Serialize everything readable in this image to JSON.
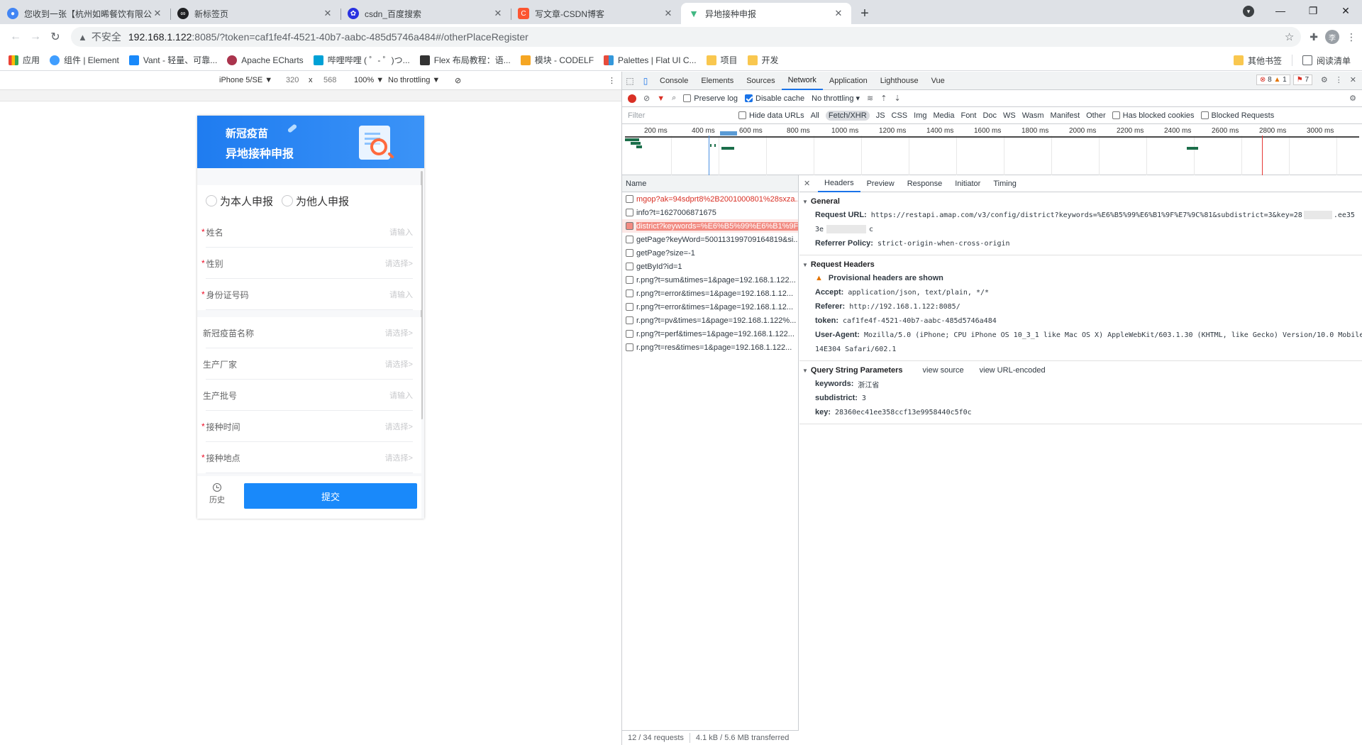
{
  "browser": {
    "tabs": [
      {
        "title": "您收到一张【杭州如晞餐饮有限公司】",
        "icon": "chrome-icon",
        "color": "#4285f4"
      },
      {
        "title": "新标签页",
        "icon": "infinity-icon",
        "color": "#202124"
      },
      {
        "title": "csdn_百度搜索",
        "icon": "baidu-paw-icon",
        "color": "#2932e1"
      },
      {
        "title": "写文章-CSDN博客",
        "icon": "csdn-icon",
        "color": "#fc5531"
      },
      {
        "title": "异地接种申报",
        "icon": "vue-icon",
        "color": "#42b883"
      }
    ],
    "new_tab": "+",
    "url_warning": "不安全",
    "url_host": "192.168.1.122",
    "url_rest": ":8085/?token=caf1fe4f-4521-40b7-aabc-485d5746a484#/otherPlaceRegister",
    "bookmarks": [
      {
        "label": "应用",
        "color": "#4285f4"
      },
      {
        "label": "组件 | Element",
        "color": "#409eff"
      },
      {
        "label": "Vant - 轻量、可靠...",
        "color": "#1989fa"
      },
      {
        "label": "Apache ECharts",
        "color": "#aa344d"
      },
      {
        "label": "哔哩哔哩 ( ゜- ゜)つ...",
        "color": "#00a1d6"
      },
      {
        "label": "Flex 布局教程：语...",
        "color": "#333333"
      },
      {
        "label": "模块 - CODELF",
        "color": "#f5a623"
      },
      {
        "label": "Palettes | Flat UI C...",
        "color": "#e74c3c"
      },
      {
        "label": "项目",
        "color": "#f9c74f"
      },
      {
        "label": "开发",
        "color": "#f9c74f"
      }
    ],
    "other_bookmarks": "其他书签",
    "reading_list": "阅读清单",
    "avatar_letter": "李"
  },
  "device_toolbar": {
    "device": "iPhone 5/SE ▼",
    "width": "320",
    "times": "x",
    "height": "568",
    "zoom": "100% ▼",
    "throttle": "No throttling ▼"
  },
  "app": {
    "banner_line1": "新冠疫苗",
    "banner_line2": "异地接种申报",
    "radio_self": "为本人申报",
    "radio_other": "为他人申报",
    "fields": [
      {
        "label": "姓名",
        "required": "*",
        "placeholder": "请输入"
      },
      {
        "label": "性别",
        "required": "*",
        "placeholder": "请选择>"
      },
      {
        "label": "身份证号码",
        "required": "*",
        "placeholder": "请输入"
      },
      {
        "label": "新冠疫苗名称",
        "required": "",
        "placeholder": "请选择>"
      },
      {
        "label": "生产厂家",
        "required": "",
        "placeholder": "请选择>"
      },
      {
        "label": "生产批号",
        "required": "",
        "placeholder": "请输入"
      },
      {
        "label": "接种时间",
        "required": "*",
        "placeholder": "请选择>"
      },
      {
        "label": "接种地点",
        "required": "*",
        "placeholder": "请选择>"
      }
    ],
    "history": "历史",
    "submit": "提交"
  },
  "devtools": {
    "tabs": [
      "Console",
      "Elements",
      "Sources",
      "Network",
      "Application",
      "Lighthouse",
      "Vue"
    ],
    "active_tab": "Network",
    "errors": "8",
    "warnings": "1",
    "issues": "7",
    "preserve_log": "Preserve log",
    "disable_cache": "Disable cache",
    "throttling": "No throttling",
    "filter_placeholder": "Filter",
    "hide_data_urls": "Hide data URLs",
    "types": [
      "All",
      "Fetch/XHR",
      "JS",
      "CSS",
      "Img",
      "Media",
      "Font",
      "Doc",
      "WS",
      "Wasm",
      "Manifest",
      "Other"
    ],
    "has_blocked_cookies": "Has blocked cookies",
    "blocked_requests": "Blocked Requests",
    "ticks": [
      "200 ms",
      "400 ms",
      "600 ms",
      "800 ms",
      "1000 ms",
      "1200 ms",
      "1400 ms",
      "1600 ms",
      "1800 ms",
      "2000 ms",
      "2200 ms",
      "2400 ms",
      "2600 ms",
      "2800 ms",
      "3000 ms"
    ],
    "name_header": "Name",
    "requests": [
      {
        "name": "mgop?ak=94sdprt8%2B2001000801%28sxza...",
        "state": "err"
      },
      {
        "name": "info?t=1627006871675",
        "state": ""
      },
      {
        "name": "district?keywords=%E6%B5%99%E6%B1%9F...",
        "state": "sel"
      },
      {
        "name": "getPage?keyWord=500113199709164819&si...",
        "state": ""
      },
      {
        "name": "getPage?size=-1",
        "state": ""
      },
      {
        "name": "getById?id=1",
        "state": ""
      },
      {
        "name": "r.png?t=sum&times=1&page=192.168.1.122...",
        "state": ""
      },
      {
        "name": "r.png?t=error&times=1&page=192.168.1.12...",
        "state": ""
      },
      {
        "name": "r.png?t=error&times=1&page=192.168.1.12...",
        "state": ""
      },
      {
        "name": "r.png?t=pv&times=1&page=192.168.1.122%...",
        "state": ""
      },
      {
        "name": "r.png?t=perf&times=1&page=192.168.1.122...",
        "state": ""
      },
      {
        "name": "r.png?t=res&times=1&page=192.168.1.122...",
        "state": ""
      }
    ],
    "status_requests": "12 / 34 requests",
    "status_transfer": "4.1 kB / 5.6 MB transferred",
    "detail_tabs": [
      "Headers",
      "Preview",
      "Response",
      "Initiator",
      "Timing"
    ],
    "general_title": "General",
    "request_url_key": "Request URL:",
    "request_url_val": "https://restapi.amap.com/v3/config/district?keywords=%E6%B5%99%E6%B1%9F%E7%9C%81&subdistrict=3&key=28",
    "request_url_tail1": ".ee35",
    "request_url_tail2": "3e",
    "request_url_tail3": "c",
    "referrer_policy_key": "Referrer Policy:",
    "referrer_policy_val": "strict-origin-when-cross-origin",
    "request_headers_title": "Request Headers",
    "provisional": "Provisional headers are shown",
    "accept_key": "Accept:",
    "accept_val": "application/json, text/plain, */*",
    "referer_key": "Referer:",
    "referer_val": "http://192.168.1.122:8085/",
    "token_key": "token:",
    "token_val": "caf1fe4f-4521-40b7-aabc-485d5746a484",
    "ua_key": "User-Agent:",
    "ua_val": "Mozilla/5.0 (iPhone; CPU iPhone OS 10_3_1 like Mac OS X) AppleWebKit/603.1.30 (KHTML, like Gecko) Version/10.0 Mobile/",
    "ua_val2": "14E304 Safari/602.1",
    "qs_title": "Query String Parameters",
    "view_source": "view source",
    "view_url_encoded": "view URL-encoded",
    "keywords_key": "keywords:",
    "keywords_val": "浙江省",
    "subdistrict_key": "subdistrict:",
    "subdistrict_val": "3",
    "key_key": "key:",
    "key_val": "28360ec41ee358ccf13e9958440c5f0c"
  }
}
